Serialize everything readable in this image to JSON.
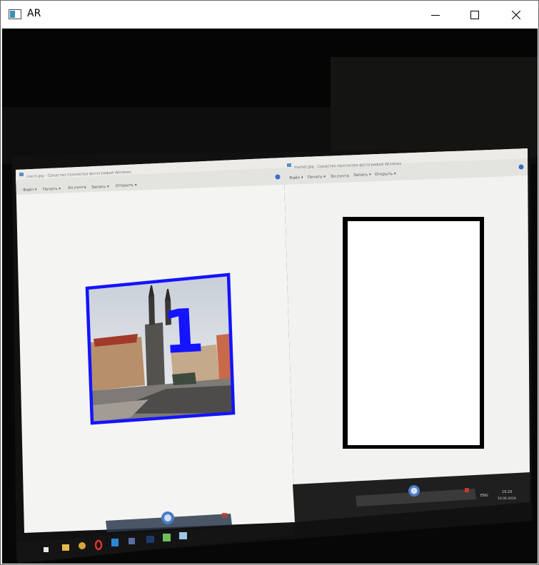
{
  "window": {
    "title": "AR",
    "icons": {
      "app": "app-window-icon",
      "minimize": "minimize-icon",
      "maximize": "maximize-icon",
      "close": "close-icon"
    }
  },
  "camera_feed": {
    "left_viewer": {
      "title": "czech.jpg - Средство просмотра фотографий Windows",
      "menu": [
        "Файл ▾",
        "Печать ▾",
        "Эл.почта",
        "Запись ▾",
        "Открыть ▾"
      ],
      "overlay_label": "1",
      "overlay_color": "#1414ff"
    },
    "right_viewer": {
      "title": "marker.jpg - Средство просмотра фотографий Windows",
      "menu": [
        "Файл ▾",
        "Печать ▾",
        "Эл.почта",
        "Запись ▾",
        "Открыть ▾"
      ],
      "clock": {
        "time": "19:20",
        "date": "10.06.2019"
      },
      "lang": "ENG"
    },
    "taskbar_icons": [
      "windows-start-icon",
      "file-explorer-icon",
      "chrome-icon",
      "opera-icon",
      "vscode-icon",
      "app-icon",
      "photoshop-icon",
      "android-studio-icon",
      "photo-viewer-icon"
    ]
  }
}
